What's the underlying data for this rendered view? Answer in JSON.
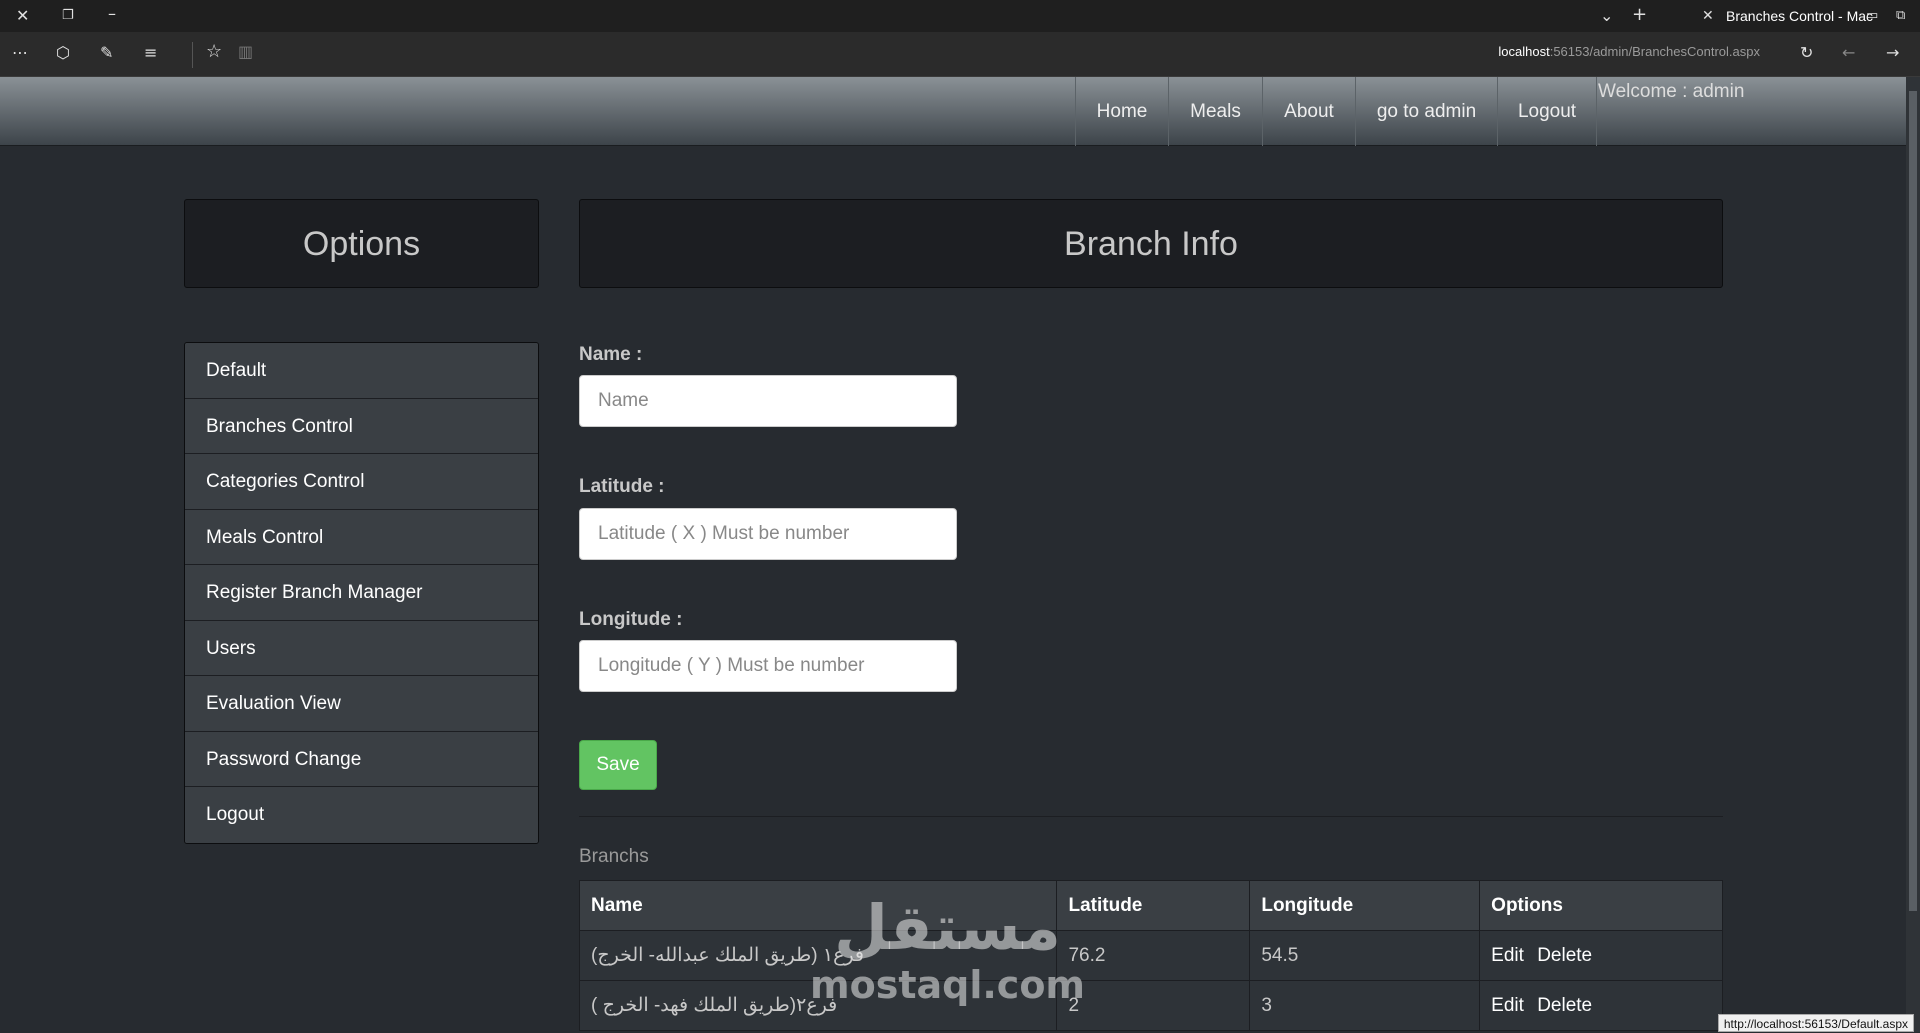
{
  "browser": {
    "tab_title": "Branches Control - Mac",
    "url_host": "localhost",
    "url_path": ":56153/admin/BranchesControl.aspx",
    "status_url": "http://localhost:56153/Default.aspx"
  },
  "nav": {
    "items": [
      "Home",
      "Meals",
      "About",
      "go to admin",
      "Logout"
    ],
    "welcome": "Welcome : admin"
  },
  "sidebar": {
    "title": "Options",
    "items": [
      "Default",
      "Branches Control",
      "Categories Control",
      "Meals Control",
      "Register Branch Manager",
      "Users",
      "Evaluation View",
      "Password Change",
      "Logout"
    ]
  },
  "form": {
    "title": "Branch Info",
    "name_label": "Name :",
    "name_placeholder": "Name",
    "latitude_label": "Latitude :",
    "latitude_placeholder": "Latitude ( X ) Must be number",
    "longitude_label": "Longitude :",
    "longitude_placeholder": "Longitude ( Y ) Must be number",
    "save_label": "Save"
  },
  "table": {
    "caption": "Branchs",
    "headers": [
      "Name",
      "Latitude",
      "Longitude",
      "Options"
    ],
    "rows": [
      {
        "name": "فرع١ (طريق الملك عبدالله- الخرج)",
        "latitude": "76.2",
        "longitude": "54.5"
      },
      {
        "name": "فرع٢(طريق الملك فهد- الخرج )",
        "latitude": "2",
        "longitude": "3"
      }
    ],
    "edit_label": "Edit",
    "delete_label": "Delete"
  },
  "watermark": {
    "arabic": "مستقل",
    "latin": "mostaql.com"
  },
  "colors": {
    "background": "#272b30",
    "save_button": "#62c462",
    "menu_item": "#3a3f44"
  }
}
